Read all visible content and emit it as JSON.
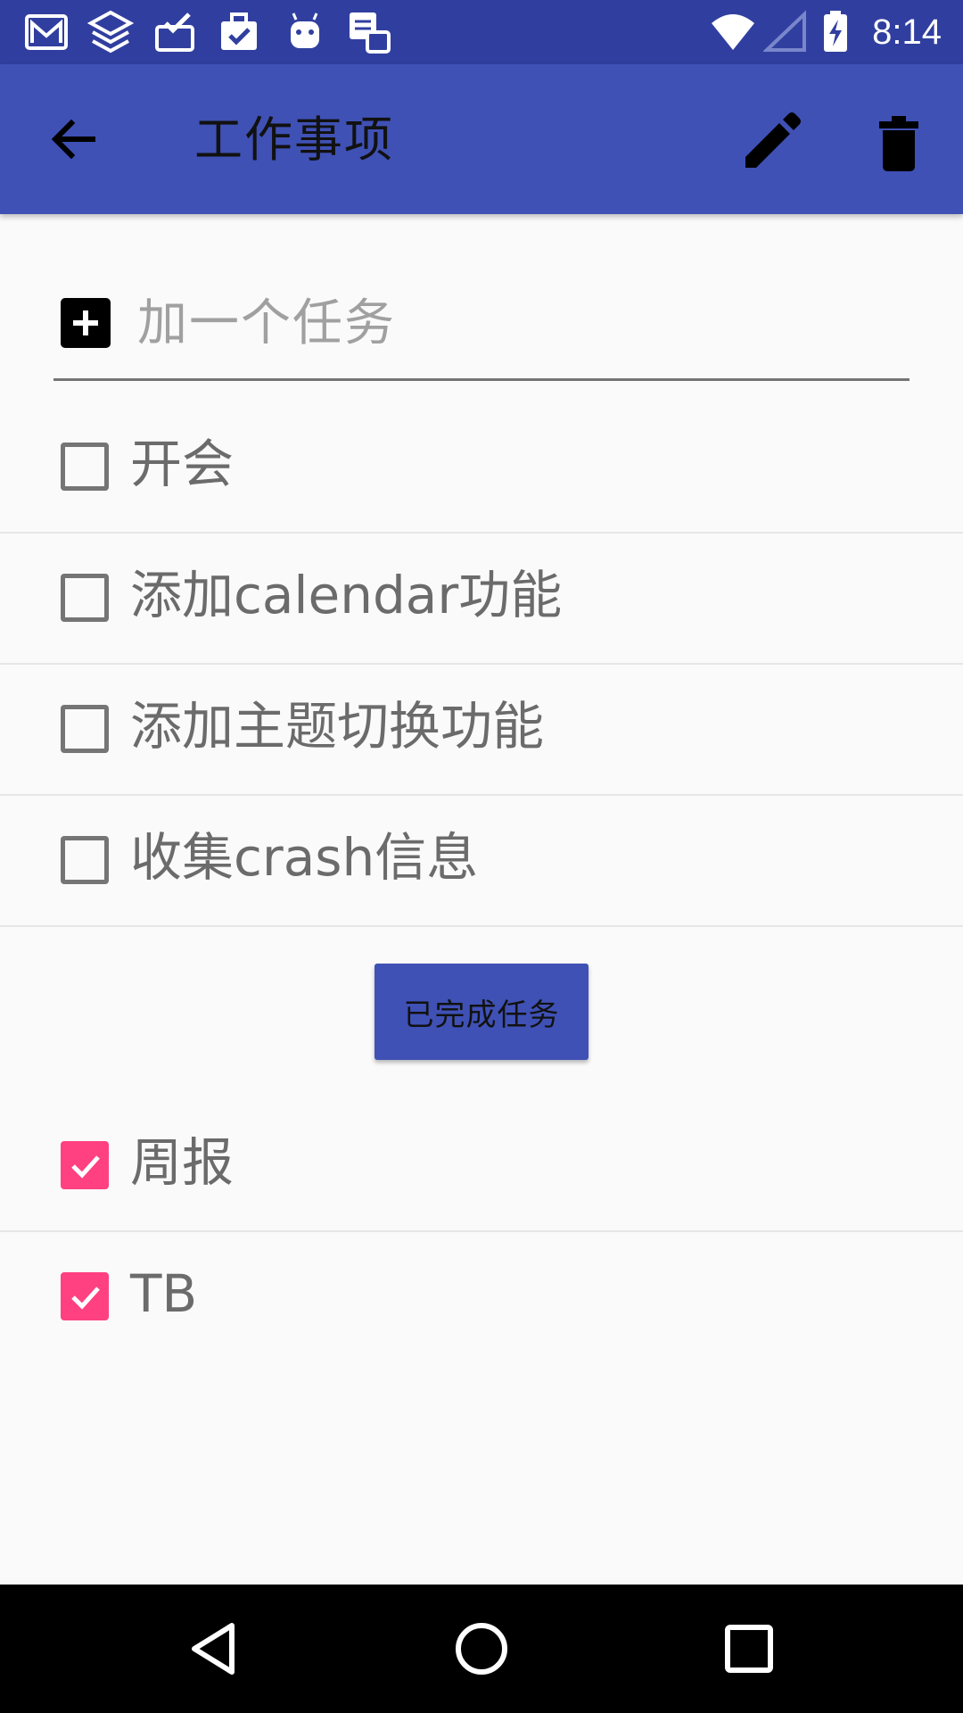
{
  "status_bar": {
    "time": "8:14",
    "icons": [
      "gmail-icon",
      "layers-icon",
      "inbox-check-icon",
      "briefcase-check-icon",
      "android-icon",
      "stack-notes-icon",
      "wifi-icon",
      "signal-icon",
      "battery-charging-icon"
    ]
  },
  "app_bar": {
    "title": "工作事项",
    "back_icon": "arrow-back-icon",
    "edit_icon": "pencil-icon",
    "delete_icon": "trash-icon",
    "color": "#3f51b5"
  },
  "add_task": {
    "placeholder": "加一个任务",
    "value": ""
  },
  "tasks": [
    {
      "label": "开会",
      "checked": false
    },
    {
      "label": "添加calendar功能",
      "checked": false
    },
    {
      "label": "添加主题切换功能",
      "checked": false
    },
    {
      "label": "收集crash信息",
      "checked": false
    }
  ],
  "completed_button": {
    "label": "已完成任务"
  },
  "completed_tasks": [
    {
      "label": "周报",
      "checked": true
    },
    {
      "label": "TB",
      "checked": true
    }
  ],
  "colors": {
    "status_bar": "#303f9f",
    "checked": "#ff4081",
    "unchecked": "#757575"
  },
  "nav_bar": {
    "back": "nav-back-icon",
    "home": "nav-home-icon",
    "recents": "nav-recents-icon"
  }
}
